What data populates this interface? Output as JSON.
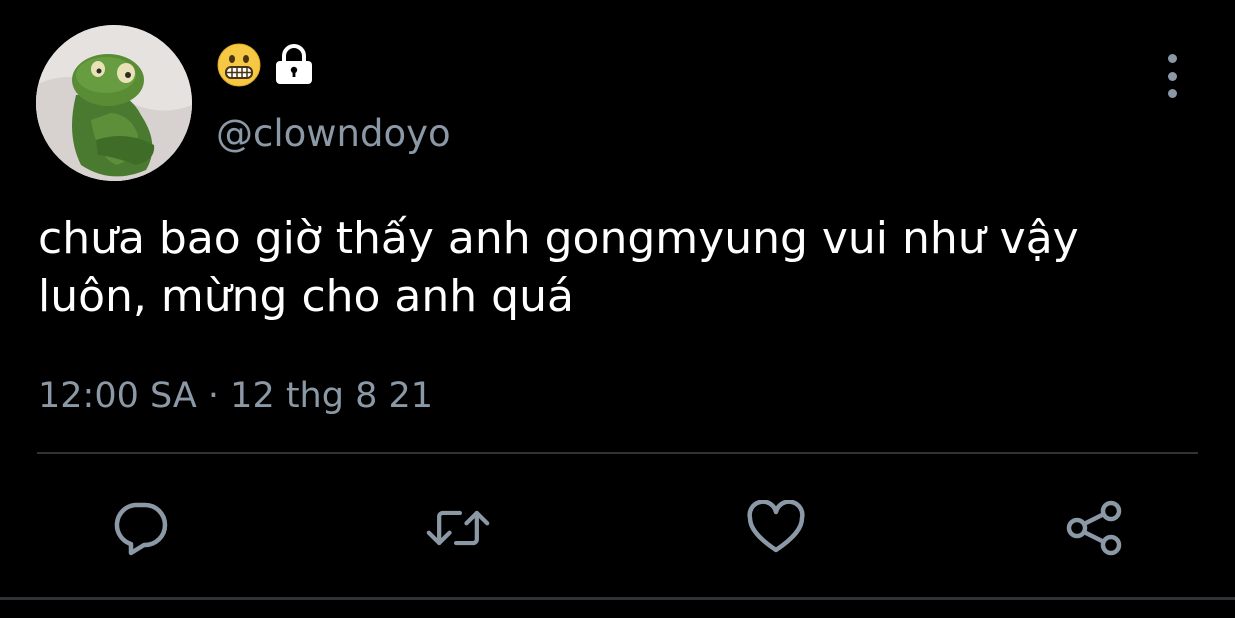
{
  "colors": {
    "background": "#000000",
    "text_primary": "#ffffff",
    "text_secondary": "#8b98a5",
    "divider": "#2f3336",
    "icon": "#8b98a5"
  },
  "author": {
    "display_name_icons": [
      "grimacing-face-emoji",
      "lock-icon"
    ],
    "handle": "@clowndoyo",
    "avatar": "green-plush-frog-avatar"
  },
  "tweet": {
    "text": "chưa bao giờ thấy anh gongmyung vui như vậy\nluôn, mừng cho anh quá",
    "timestamp": "12:00 SA · 12 thg 8 21"
  },
  "actions": [
    {
      "name": "reply",
      "icon": "speech-bubble-icon"
    },
    {
      "name": "retweet",
      "icon": "retweet-icon"
    },
    {
      "name": "like",
      "icon": "heart-icon"
    },
    {
      "name": "share",
      "icon": "share-icon"
    }
  ],
  "menu": {
    "icon": "more-vertical-icon"
  }
}
